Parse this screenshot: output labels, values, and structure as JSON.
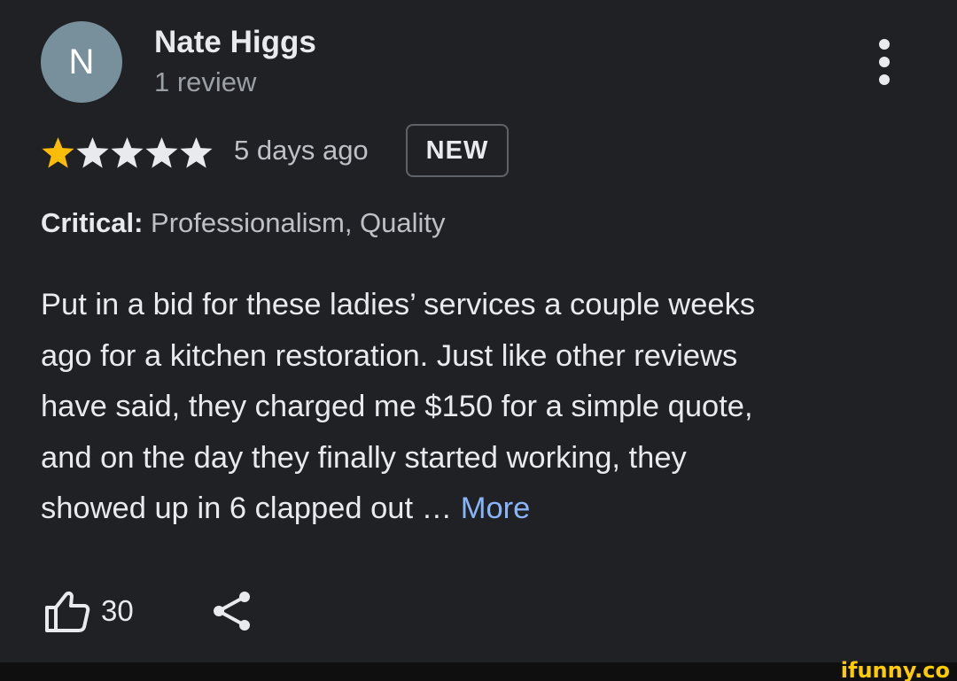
{
  "author": {
    "initial": "N",
    "name": "Nate Higgs",
    "review_count": "1 review",
    "avatar_color": "#78909c"
  },
  "rating": {
    "stars": 1,
    "max_stars": 5,
    "filled_color": "#fbbc04",
    "empty_color": "#e8eaed",
    "time_ago": "5 days ago",
    "badge": "NEW"
  },
  "critical": {
    "label": "Critical:",
    "value": " Professionalism, Quality"
  },
  "review": {
    "lines": [
      "Put in a bid for these ladies’ services a couple weeks",
      "ago for a kitchen restoration. Just like other reviews",
      "have said, they charged me $150 for a simple quote,",
      "and on the day they finally started working, they",
      "showed up in 6 clapped out … "
    ],
    "more_label": "More",
    "more_color": "#8ab4f8"
  },
  "actions": {
    "like_count": "30",
    "like_icon": "thumbs-up-icon",
    "share_icon": "share-icon",
    "menu_icon": "more-vert-icon"
  },
  "watermark": "ifunny.co"
}
